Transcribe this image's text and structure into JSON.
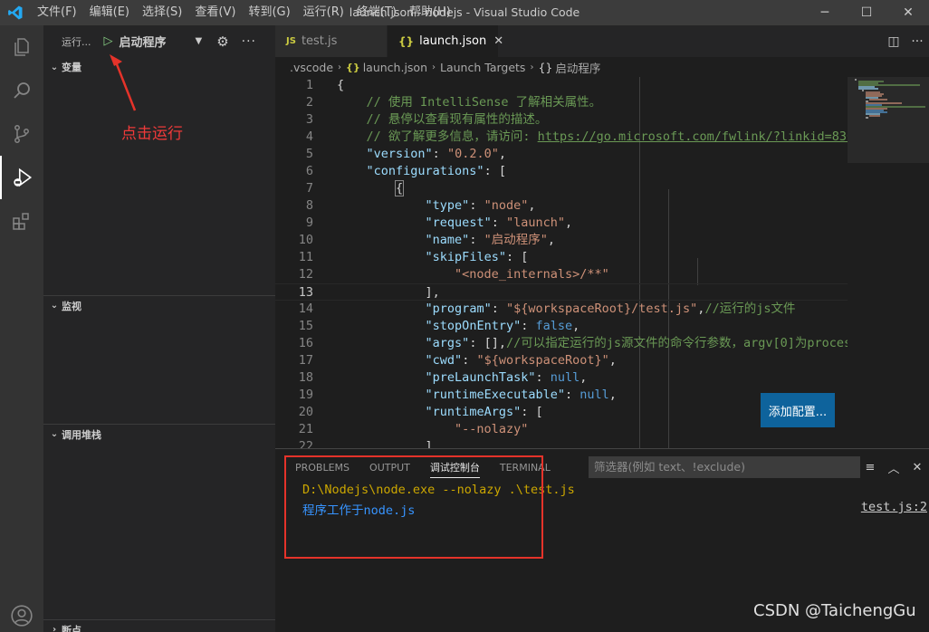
{
  "titlebar": {
    "menu": [
      "文件(F)",
      "编辑(E)",
      "选择(S)",
      "查看(V)",
      "转到(G)",
      "运行(R)",
      "终端(T)",
      "帮助(H)"
    ],
    "title": "launch.json - nodejs - Visual Studio Code",
    "controls": {
      "minimize": "─",
      "maximize": "☐",
      "close": "✕"
    }
  },
  "sidebar": {
    "run_label": "运行...",
    "config_name": "启动程序",
    "sections": {
      "variables": "变量",
      "watch": "监视",
      "callstack": "调用堆栈",
      "breakpoints": "断点"
    },
    "annotation": "点击运行"
  },
  "tabs": [
    {
      "label": "test.js",
      "icon": "JS",
      "active": false
    },
    {
      "label": "launch.json",
      "icon": "{}",
      "active": true
    }
  ],
  "breadcrumb": [
    ".vscode",
    "launch.json",
    "Launch Targets",
    "启动程序"
  ],
  "editor": {
    "current_line": 13,
    "add_config_button": "添加配置..."
  },
  "panel": {
    "tabs": [
      "PROBLEMS",
      "OUTPUT",
      "调试控制台",
      "TERMINAL"
    ],
    "active_tab": "调试控制台",
    "filter_placeholder": "筛选器(例如 text、!exclude)",
    "console": {
      "line1": "D:\\Nodejs\\node.exe --nolazy .\\test.js",
      "line2": "程序工作于node.js",
      "source": "test.js:2"
    }
  },
  "watermark": "CSDN @TaichengGu",
  "colors": {
    "accent": "#0e639c",
    "annotation": "#e5332a"
  }
}
